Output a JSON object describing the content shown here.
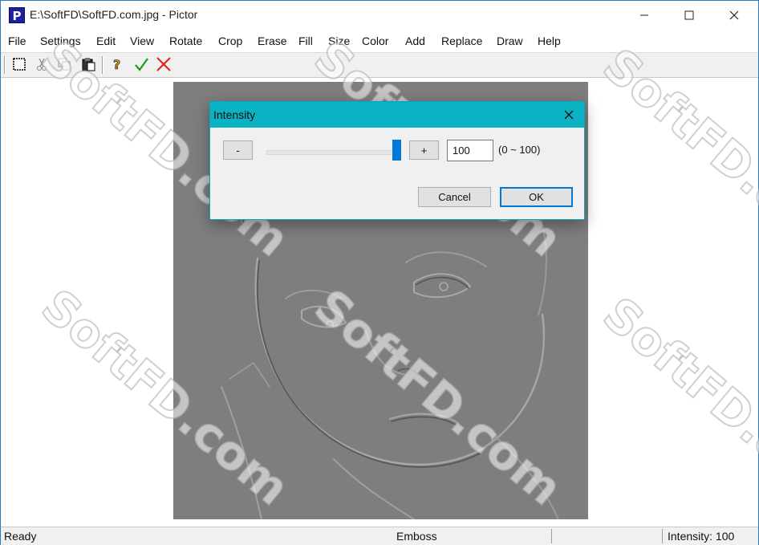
{
  "window": {
    "title": "E:\\SoftFD\\SoftFD.com.jpg - Pictor",
    "app_icon_letter": "P"
  },
  "menu": [
    "File",
    "Settings",
    "Edit",
    "View",
    "Rotate",
    "Crop",
    "Erase",
    "Fill",
    "Size",
    "Color",
    "Add",
    "Replace",
    "Draw",
    "Help"
  ],
  "toolbar": {
    "buttons": [
      "select-icon",
      "cut-icon",
      "copy-icon",
      "paste-icon",
      "help-icon",
      "apply-check-icon",
      "cancel-x-icon"
    ],
    "colors": {
      "check": "#1a9c1a",
      "cross": "#e02020",
      "help": "#d4a000"
    }
  },
  "dialog": {
    "title": "Intensity",
    "minus_label": "-",
    "plus_label": "+",
    "value": "100",
    "range_label": "(0 ~ 100)",
    "slider_value": 100,
    "slider_min": 0,
    "slider_max": 100,
    "cancel_label": "Cancel",
    "ok_label": "OK",
    "accent_color": "#0ab2c3"
  },
  "status": {
    "left": "Ready",
    "middle": "Emboss",
    "right": "Intensity: 100"
  },
  "watermark": "SoftFD.com"
}
